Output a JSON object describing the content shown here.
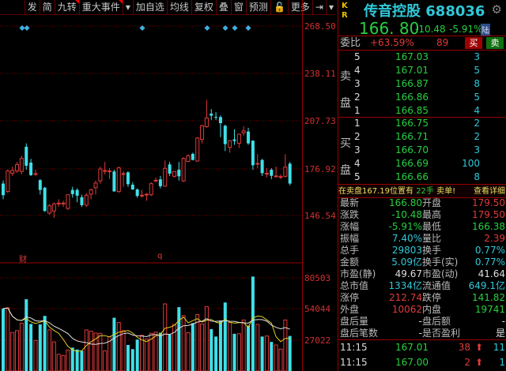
{
  "toolbar": {
    "items": [
      "发",
      "简",
      "九转",
      "重大事件",
      "▾",
      "加自选",
      "均线",
      "复权",
      "叠",
      "窗",
      "预测",
      "🔓",
      "更多",
      "⇥",
      "▾"
    ]
  },
  "axis": {
    "price": [
      "268.50",
      "238.11",
      "207.73",
      "176.92",
      "146.54"
    ],
    "volume": [
      "80503",
      "54044",
      "27022"
    ]
  },
  "markers": {
    "cai": "财",
    "q": "q"
  },
  "colors": {
    "up": "#e03a3a",
    "down": "#40e0e8",
    "ma5": "#e0d020",
    "ma10": "#e0e0e0",
    "grid": "#7a0000"
  },
  "chart_data": {
    "type": "candlestick",
    "ylim": [
      146.54,
      268.5
    ],
    "ohlc": [
      [
        167.1,
        169,
        157,
        159.6
      ],
      [
        162,
        176,
        161,
        175.2
      ],
      [
        173.8,
        178,
        172,
        175.5
      ],
      [
        175.2,
        181,
        174,
        179.3
      ],
      [
        174.9,
        185,
        173,
        183.3
      ],
      [
        190.8,
        193,
        176,
        178.6
      ],
      [
        180.6,
        183,
        172,
        172.5
      ],
      [
        173.5,
        176,
        172,
        173.5
      ],
      [
        169.3,
        170,
        160,
        163
      ],
      [
        164.4,
        165,
        149,
        149.4
      ],
      [
        148.1,
        154,
        147,
        152.8
      ],
      [
        149.4,
        155,
        145,
        154
      ],
      [
        154.5,
        157,
        152,
        154.5
      ],
      [
        154.3,
        156,
        152,
        154.5
      ],
      [
        151.1,
        160,
        150,
        159.9
      ],
      [
        163,
        165,
        158,
        160.3
      ],
      [
        163,
        164,
        155,
        159.3
      ],
      [
        158.3,
        160,
        152,
        153.2
      ],
      [
        153.2,
        161,
        152,
        159.6
      ],
      [
        160.3,
        164,
        157,
        163
      ],
      [
        164.4,
        169,
        160,
        167.4
      ],
      [
        168.8,
        178,
        167,
        176.5
      ],
      [
        175.5,
        181,
        173,
        175.5
      ],
      [
        175,
        177,
        170,
        175.2
      ],
      [
        174.9,
        176,
        162,
        162
      ],
      [
        162,
        178,
        161,
        177.2
      ],
      [
        173.5,
        175,
        165,
        173.5
      ],
      [
        174.3,
        175,
        165,
        166.7
      ],
      [
        166.4,
        168,
        163,
        163.3
      ],
      [
        163.3,
        164,
        158,
        159.1
      ],
      [
        159.6,
        163,
        158,
        159.6
      ],
      [
        160,
        161,
        156,
        160.2
      ],
      [
        159.9,
        168,
        159,
        167
      ],
      [
        169,
        171,
        168,
        169.2
      ],
      [
        169.8,
        172,
        164,
        165.4
      ],
      [
        165.4,
        182,
        165,
        176.9
      ],
      [
        179.4,
        181,
        172,
        173.5
      ],
      [
        171.8,
        175,
        171,
        174.9
      ],
      [
        176,
        181,
        169,
        171.8
      ],
      [
        168.8,
        184,
        168,
        183.3
      ],
      [
        181.3,
        186,
        181,
        185
      ],
      [
        186.2,
        187,
        182,
        182.3
      ],
      [
        181.6,
        197,
        181,
        196.4
      ],
      [
        195.5,
        205,
        193,
        204.3
      ],
      [
        203.7,
        221,
        203,
        209.4
      ],
      [
        212.1,
        215,
        208,
        210.8
      ],
      [
        210,
        213,
        208,
        209.8
      ],
      [
        209.9,
        211,
        197,
        206
      ],
      [
        204.3,
        205,
        188,
        192.5
      ],
      [
        190.4,
        195,
        187,
        194.7
      ],
      [
        195.5,
        202,
        192,
        194.5
      ],
      [
        193,
        199,
        190,
        198.9
      ],
      [
        199.8,
        204,
        198,
        201
      ],
      [
        200.6,
        203,
        192,
        193
      ],
      [
        194.7,
        195,
        176,
        178.9
      ],
      [
        179.8,
        186,
        177,
        180.1
      ],
      [
        182.3,
        183,
        172,
        173.8
      ],
      [
        173.5,
        177,
        171,
        173.7
      ],
      [
        176,
        177,
        170,
        172.1
      ],
      [
        172,
        178,
        171,
        172
      ],
      [
        171.5,
        173,
        170,
        171.6
      ],
      [
        171.8,
        186,
        171,
        177.7
      ],
      [
        179.9,
        181,
        166,
        167.1
      ]
    ],
    "volume": [
      54200,
      54900,
      33700,
      35300,
      41700,
      62200,
      41000,
      26900,
      40600,
      47900,
      35900,
      25600,
      15000,
      13900,
      18700,
      20700,
      19100,
      18000,
      35900,
      34800,
      33200,
      33000,
      18000,
      30200,
      46300,
      42200,
      35300,
      23000,
      19400,
      27600,
      31300,
      28100,
      33000,
      34000,
      33500,
      58200,
      32100,
      40600,
      55400,
      48100,
      33500,
      41700,
      49000,
      41000,
      55800,
      36600,
      30200,
      43900,
      59400,
      42200,
      32600,
      32600,
      44400,
      39500,
      81600,
      40600,
      30200,
      30700,
      25600,
      23000,
      19400,
      44400,
      30700
    ],
    "volume_ylim": [
      0,
      80503
    ]
  },
  "quote": {
    "kr": [
      "K",
      "R"
    ],
    "name": "传音控股",
    "code": "688036",
    "price": "166. 80",
    "change": "-10.48",
    "pct": "-5.91%",
    "lu": "陆",
    "weibi_label": "委比",
    "weibi": "+63.59%",
    "weicha": "89",
    "buy_btn": "买",
    "sell_btn": "卖",
    "sell_label": [
      "卖",
      "盘"
    ],
    "buy_label": [
      "买",
      "盘"
    ],
    "asks": [
      {
        "lvl": "5",
        "p": "167.03",
        "v": "3"
      },
      {
        "lvl": "4",
        "p": "167.01",
        "v": "5"
      },
      {
        "lvl": "3",
        "p": "166.87",
        "v": "8"
      },
      {
        "lvl": "2",
        "p": "166.86",
        "v": "5"
      },
      {
        "lvl": "1",
        "p": "166.85",
        "v": "4"
      }
    ],
    "bids": [
      {
        "lvl": "1",
        "p": "166.75",
        "v": "2"
      },
      {
        "lvl": "2",
        "p": "166.71",
        "v": "2"
      },
      {
        "lvl": "3",
        "p": "166.70",
        "v": "3"
      },
      {
        "lvl": "4",
        "p": "166.69",
        "v": "100"
      },
      {
        "lvl": "5",
        "p": "166.66",
        "v": "8"
      }
    ],
    "notice": {
      "a": "在卖盘",
      "b": "167.19",
      "c": "位置有",
      "d": "22手",
      "e": "卖单!",
      "detail": "查看详细"
    },
    "stats": [
      {
        "l1": "最新",
        "v1": "166.80",
        "c1": "g",
        "l2": "开盘",
        "v2": "179.50",
        "c2": "r"
      },
      {
        "l1": "涨跌",
        "v1": "-10.48",
        "c1": "g",
        "l2": "最高",
        "v2": "179.50",
        "c2": "r"
      },
      {
        "l1": "涨幅",
        "v1": "-5.91%",
        "c1": "g",
        "l2": "最低",
        "v2": "166.38",
        "c2": "g"
      },
      {
        "l1": "振幅",
        "v1": "7.40%",
        "c1": "c",
        "l2": "量比",
        "v2": "2.39",
        "c2": "r"
      },
      {
        "l1": "总手",
        "v1": "29803",
        "c1": "c",
        "l2": "换手",
        "v2": "0.77%",
        "c2": "c"
      },
      {
        "l1": "金额",
        "v1": "5.09亿",
        "c1": "c",
        "l2": "换手(实)",
        "v2": "0.77%",
        "c2": "c"
      },
      {
        "l1": "市盈(静)",
        "v1": "49.67",
        "c1": "w",
        "l2": "市盈(动)",
        "v2": "41.64",
        "c2": "w"
      },
      {
        "l1": "总市值",
        "v1": "1334亿",
        "c1": "c",
        "l2": "流通值",
        "v2": "649.1亿",
        "c2": "c"
      },
      {
        "l1": "涨停",
        "v1": "212.74",
        "c1": "r",
        "l2": "跌停",
        "v2": "141.82",
        "c2": "g"
      },
      {
        "l1": "外盘",
        "v1": "10062",
        "c1": "r",
        "l2": "内盘",
        "v2": "19741",
        "c2": "g"
      },
      {
        "l1": "盘后量",
        "v1": "-",
        "c1": "w",
        "l2": "盘后额",
        "v2": "-",
        "c2": "w"
      },
      {
        "l1": "盘后笔数",
        "v1": "-",
        "c1": "w",
        "l2": "是否盈利",
        "v2": "是",
        "c2": "w"
      }
    ],
    "ticks": [
      {
        "t": "11:15",
        "p": "167.01",
        "v": "38",
        "n": "11"
      },
      {
        "t": "11:15",
        "p": "167.00",
        "v": "2",
        "n": "1"
      }
    ]
  }
}
